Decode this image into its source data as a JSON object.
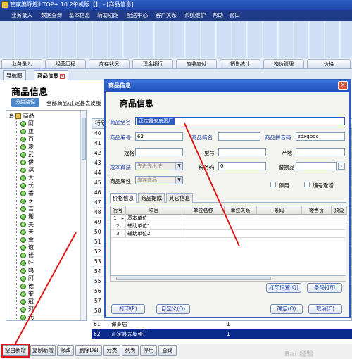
{
  "window": {
    "title": "管家婆辉煌Ⅱ TOP+ 10.2单机版【】 - [商品信息]"
  },
  "menu": [
    "业务录入",
    "数据查询",
    "基本信息",
    "辅助功能",
    "配送中心",
    "客户关系",
    "系统维护",
    "帮助",
    "窗口"
  ],
  "nav_tabs": [
    "业务录入",
    "经营历程",
    "库存状况",
    "现金银行",
    "应收应付",
    "销售统计",
    "物价管理",
    "价格"
  ],
  "page_tabs": {
    "nav": "导航图",
    "active": "商品信息"
  },
  "page": {
    "title": "商品信息",
    "path_button": "分类路径",
    "path_text": "全部商品\\正定县去皮蛋"
  },
  "tree": {
    "root": "商品",
    "items": [
      "阿",
      "正",
      "百",
      "凌",
      "武",
      "伊",
      "福",
      "大",
      "长",
      "香",
      "芝",
      "吉",
      "谢",
      "美",
      "天",
      "金",
      "谊",
      "诺",
      "牡",
      "呜",
      "阿",
      "德",
      "安",
      "冠",
      "河",
      "元"
    ]
  },
  "grid": {
    "header": "行号",
    "rows": [
      {
        "num": "40",
        "name": "",
        "unit": ""
      },
      {
        "num": "41",
        "name": "",
        "unit": ""
      },
      {
        "num": "42",
        "name": "",
        "unit": ""
      },
      {
        "num": "43",
        "name": "",
        "unit": ""
      },
      {
        "num": "44",
        "name": "",
        "unit": ""
      },
      {
        "num": "45",
        "name": "",
        "unit": ""
      },
      {
        "num": "46",
        "name": "",
        "unit": ""
      },
      {
        "num": "47",
        "name": "",
        "unit": ""
      },
      {
        "num": "48",
        "name": "",
        "unit": ""
      },
      {
        "num": "49",
        "name": "",
        "unit": ""
      },
      {
        "num": "50",
        "name": "",
        "unit": ""
      },
      {
        "num": "51",
        "name": "",
        "unit": ""
      },
      {
        "num": "52",
        "name": "",
        "unit": ""
      },
      {
        "num": "53",
        "name": "",
        "unit": ""
      },
      {
        "num": "54",
        "name": "",
        "unit": ""
      },
      {
        "num": "55",
        "name": "",
        "unit": ""
      },
      {
        "num": "56",
        "name": "",
        "unit": ""
      },
      {
        "num": "57",
        "name": "",
        "unit": ""
      },
      {
        "num": "58",
        "name": "",
        "unit": ""
      },
      {
        "num": "59",
        "name": "",
        "unit": ""
      },
      {
        "num": "60",
        "name": "",
        "unit": ""
      },
      {
        "num": "61",
        "name": "谭乡居",
        "unit": "1"
      },
      {
        "num": "62",
        "name": "正定县去皮蛋厂",
        "unit": "1"
      }
    ]
  },
  "bottom_buttons": [
    "空白新增",
    "复制新增",
    "修改",
    "删除Del",
    "分类",
    "列表",
    "停用",
    "查询"
  ],
  "dialog": {
    "title": "商品信息",
    "heading": "商品信息",
    "labels": {
      "full_name": "商品全名",
      "code": "商品编号",
      "short_name": "商品简名",
      "pinyin": "商品拼音码",
      "spec": "规格",
      "model": "型号",
      "origin": "产地",
      "cost_method": "成本算法",
      "tax_code": "税务码",
      "substitute": "替换品",
      "attribute": "商品属性",
      "disabled": "停用",
      "barcode_link": "编号逢增"
    },
    "values": {
      "full_name": "正定县去皮蛋厂",
      "code": "62",
      "short_name": "",
      "pinyin": "zdxqpdc",
      "spec": "",
      "model": "",
      "origin": "",
      "cost_method": "先进先出法",
      "tax_code": "0",
      "substitute": "",
      "attribute": "库存商品"
    },
    "tabs": [
      "价格信息",
      "商品提成",
      "其它信息"
    ],
    "table": {
      "headers": [
        "行号",
        "项目",
        "单位名称",
        "单位关系",
        "条码",
        "零售价",
        "预设"
      ],
      "rows": [
        {
          "num": "1",
          "item": "基本单位"
        },
        {
          "num": "2",
          "item": "辅助单位1"
        },
        {
          "num": "3",
          "item": "辅助单位2"
        }
      ]
    },
    "buttons": {
      "print_settings": "打印设置(Q)",
      "barcode_print": "条码打印",
      "print": "打印(P)",
      "customize": "自定义(Q)",
      "ok": "确定(O)",
      "cancel": "取消(C)"
    }
  },
  "watermark": "Bai 经验",
  "colors": {
    "title_bar": "#2f5fc4",
    "menu_bar": "#1f3a86",
    "selected_row": "#0a2a8c",
    "annotation": "#e01818"
  }
}
